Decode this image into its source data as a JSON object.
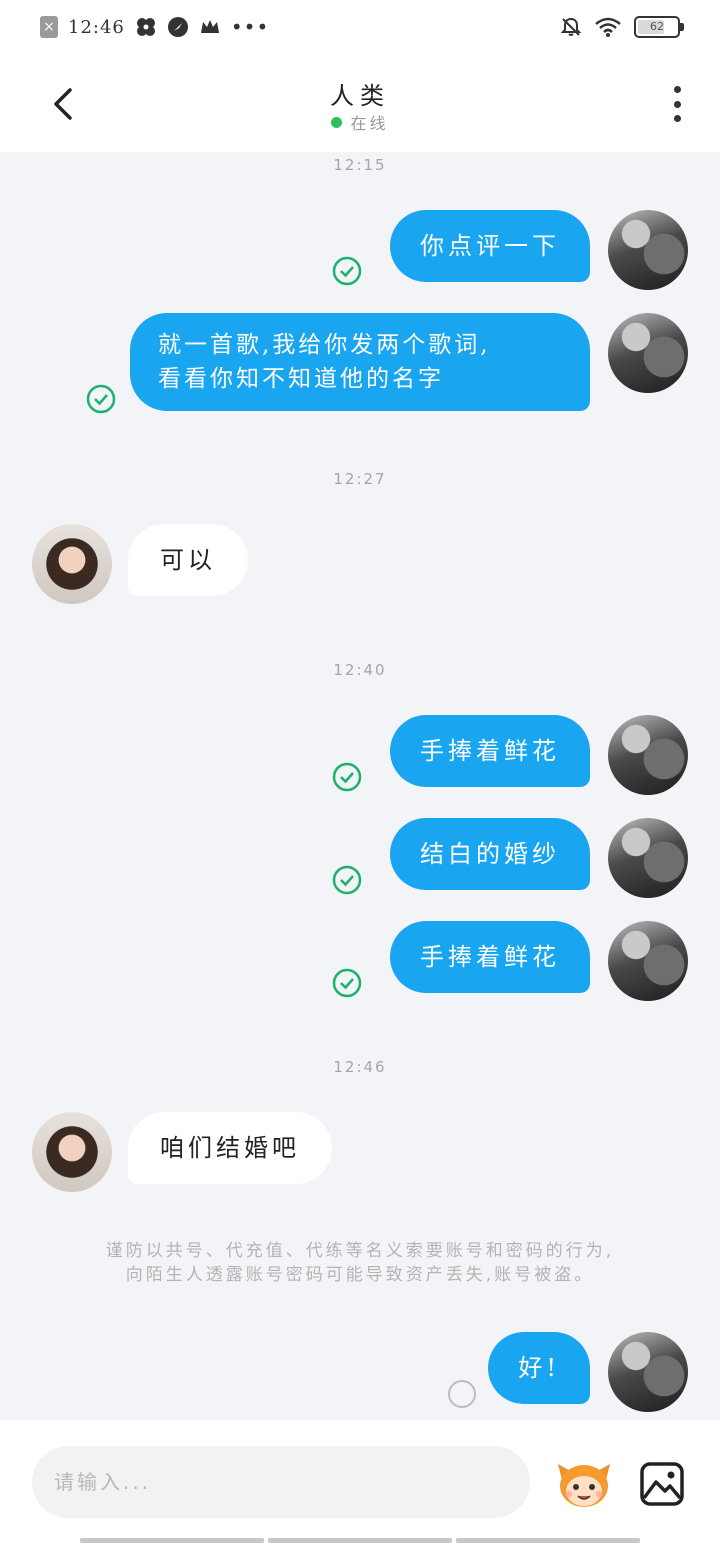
{
  "status_bar": {
    "time": "12:46",
    "battery": "62",
    "icons": [
      "close-notification-icon",
      "pinwheel-icon",
      "navigation-icon",
      "crown-icon",
      "more-dots-icon",
      "bell-muted-icon",
      "wifi-icon",
      "battery-icon"
    ]
  },
  "header": {
    "title": "人类",
    "status": "在线",
    "status_color": "#2ec05a",
    "back_icon": "chevron-left-icon",
    "menu_icon": "vertical-dots-icon"
  },
  "chat": {
    "timestamps": [
      "12:15",
      "12:27",
      "12:40",
      "12:46"
    ],
    "messages": [
      {
        "from": "me",
        "text": "你点评一下",
        "status": "delivered"
      },
      {
        "from": "me",
        "text_line1": "就一首歌,我给你发两个歌词,",
        "text_line2": "看看你知不知道他的名字",
        "status": "delivered"
      },
      {
        "from": "her",
        "text": "可以"
      },
      {
        "from": "me",
        "text": "手捧着鲜花",
        "status": "delivered"
      },
      {
        "from": "me",
        "text": "结白的婚纱",
        "status": "delivered"
      },
      {
        "from": "me",
        "text": "手捧着鲜花",
        "status": "delivered"
      },
      {
        "from": "her",
        "text": "咱们结婚吧"
      },
      {
        "from": "me",
        "text": "好!",
        "status": "sending"
      }
    ],
    "warning_line1": "谨防以共号、代充值、代练等名义索要账号和密码的行为,",
    "warning_line2": "向陌生人透露账号密码可能导致资产丢失,账号被盗。",
    "accent_color": "#1aa5f0",
    "check_color": "#1db26b"
  },
  "input_bar": {
    "placeholder": "请输入...",
    "value": "",
    "emoji_icon": "mascot-emoji-icon",
    "image_icon": "image-gallery-icon"
  }
}
